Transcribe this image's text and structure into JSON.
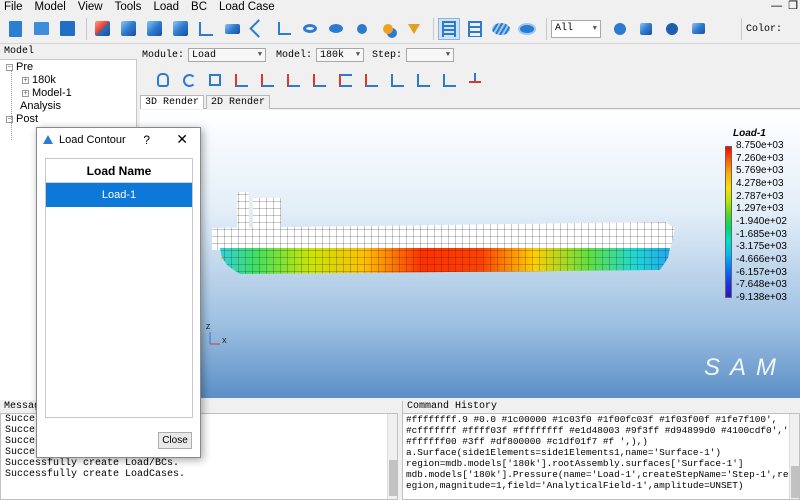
{
  "menu": [
    "File",
    "Model",
    "View",
    "Tools",
    "Load",
    "BC",
    "Load Case"
  ],
  "window_controls": {
    "minimize": "—",
    "restore": "❐"
  },
  "toolbar": {
    "filter_value": "All",
    "color_label": "Color:",
    "icons": [
      "new-file-icon",
      "open-file-icon",
      "save-icon",
      "part-cube-icon",
      "mesh-cube-icon",
      "solid-cube-icon",
      "section-cube-icon",
      "node-icon",
      "shell-icon",
      "line-icon",
      "truss-icon",
      "beam-icon",
      "ring-icon",
      "point-icon",
      "connector-icon",
      "load-arrow-icon",
      "grid-bars-icon",
      "ladder-icon",
      "disk-icon",
      "disk-filled-icon",
      "render-node-icon",
      "render-element-icon",
      "render-face-icon",
      "render-shade-icon"
    ]
  },
  "tree": {
    "header": "Model",
    "nodes": [
      {
        "label": "Pre",
        "expander": "−"
      },
      {
        "label": "180k",
        "expander": "+"
      },
      {
        "label": "Model-1",
        "expander": "+"
      },
      {
        "label": "Analysis",
        "expander": ""
      },
      {
        "label": "Post",
        "expander": "−"
      }
    ]
  },
  "module_bar": {
    "module_label": "Module:",
    "module_value": "Load",
    "model_label": "Model:",
    "model_value": "180k",
    "step_label": "Step:",
    "step_value": ""
  },
  "render_tabs": [
    "3D Render",
    "2D Render"
  ],
  "viewport": {
    "watermark": "SAM",
    "legend": {
      "title": "Load-1",
      "values": [
        "8.750e+03",
        "7.260e+03",
        "5.769e+03",
        "4.278e+03",
        "2.787e+03",
        "1.297e+03",
        "-1.940e+02",
        "-1.685e+03",
        "-3.175e+03",
        "-4.666e+03",
        "-6.157e+03",
        "-7.648e+03",
        "-9.138e+03"
      ]
    },
    "axis_labels": {
      "x": "X",
      "z": "Z"
    }
  },
  "dialog": {
    "title": "Load Contour",
    "help": "?",
    "close_x": "✕",
    "column_header": "Load Name",
    "rows": [
      "Load-1"
    ],
    "close_button": "Close"
  },
  "messages": {
    "header": "Messages",
    "lines": [
      "Successfully create Part 180k.",
      "Successfully create Model-1.",
      "Successfully create Mesh.",
      "Successfully create step.",
      "Successfully create Load/BCs.",
      "Successfully create LoadCases."
    ]
  },
  "command_history": {
    "header": "Command History",
    "lines": [
      "#ffffffff.9 #0.0 #1c00000 #1c03f0 #1f00fc03f #1f03f00f #1fe7f100',",
      "#cfffffff #ffff03f #ffffffff #e1d48003 #9f3ff #d94899d0 #4100cdf0','",
      "#ffffff00 #3ff #df800000 #c1df01f7 #f ',),)",
      "a.Surface(side1Elements=side1Elements1,name='Surface-1')",
      "region=mdb.models['180k'].rootAssembly.surfaces['Surface-1']",
      "mdb.models['180k'].Pressure(name='Load-1',createStepName='Step-1',region=r",
      "egion,magnitude=1,field='AnalyticalField-1',amplitude=UNSET)"
    ]
  }
}
